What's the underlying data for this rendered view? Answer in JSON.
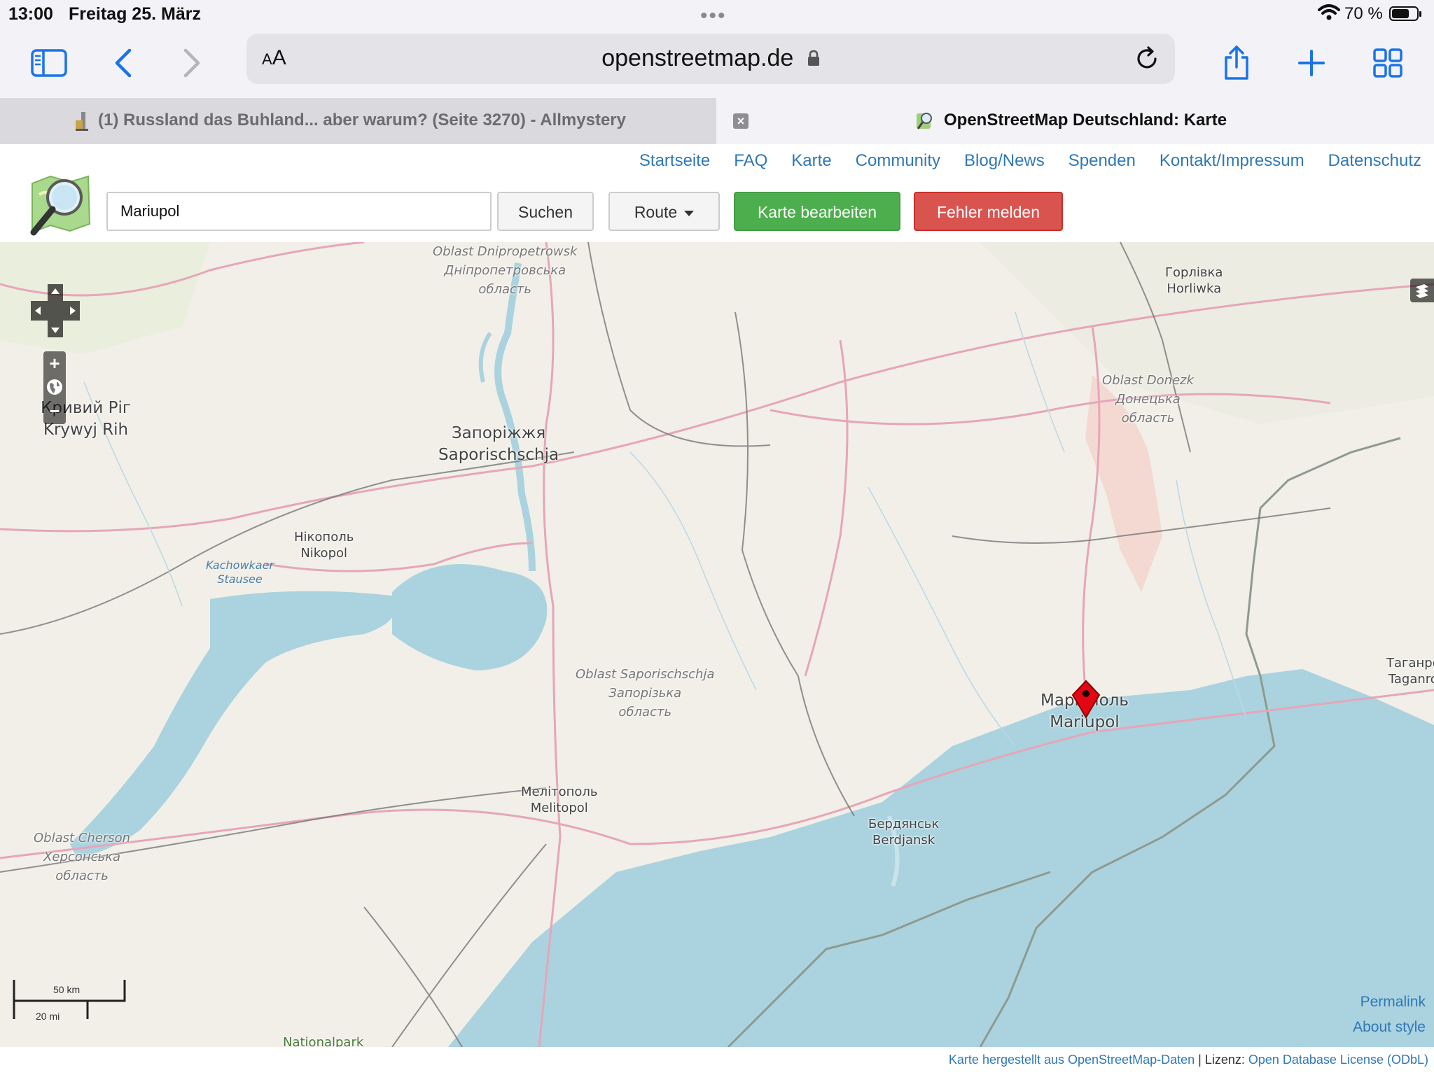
{
  "status_bar": {
    "time": "13:00",
    "date": "Freitag 25. März",
    "battery": "70 %",
    "battery_level": 0.7,
    "icons": [
      "wifi-icon",
      "battery-icon"
    ]
  },
  "browser": {
    "url": "openstreetmap.de",
    "reader_label_small": "A",
    "reader_label_large": "A",
    "toolbar_icons": [
      "sidebar-icon",
      "back-icon",
      "forward-icon",
      "lock-icon",
      "reload-icon",
      "share-icon",
      "new-tab-icon",
      "tabs-overview-icon"
    ],
    "tabs": [
      {
        "title": "(1) Russland das Buhland... aber warum? (Seite 3270) - Allmystery",
        "active": false
      },
      {
        "title": "OpenStreetMap Deutschland: Karte",
        "active": true
      }
    ]
  },
  "site": {
    "nav": [
      "Startseite",
      "FAQ",
      "Karte",
      "Community",
      "Blog/News",
      "Spenden",
      "Kontakt/Impressum",
      "Datenschutz"
    ],
    "search_value": "Mariupol",
    "buttons": {
      "search": "Suchen",
      "route": "Route",
      "edit": "Karte bearbeiten",
      "report": "Fehler melden"
    },
    "colors": {
      "edit": "#4cae4c",
      "report": "#d9534f",
      "link": "#2f78b5",
      "water": "#aad3df",
      "land": "#f1efe8"
    }
  },
  "map": {
    "labels": {
      "dnipro_oblast": [
        "Oblast Dnipropetrowsk",
        "Дніпропетровська",
        "область"
      ],
      "kryvyi_rih": [
        "Кривий Ріг",
        "Krywyj Rih"
      ],
      "zaporizhzhia": [
        "Запоріжжя",
        "Saporischschja"
      ],
      "horlivka": [
        "Горлівка",
        "Horliwka"
      ],
      "donetsk_oblast": [
        "Oblast Donezk",
        "Донецька",
        "область"
      ],
      "nikopol": [
        "Нікополь",
        "Nikopol"
      ],
      "reservoir": [
        "Kachowkaer",
        "Stausee"
      ],
      "zap_oblast": [
        "Oblast Saporischschja",
        "Запорізька",
        "область"
      ],
      "mariupol": [
        "Маріуполь",
        "Mariupol"
      ],
      "taganrog": [
        "Таганро",
        "Taganro"
      ],
      "melitopol": [
        "Мелітополь",
        "Melitopol"
      ],
      "berdyansk": [
        "Бердянськ",
        "Berdjansk"
      ],
      "kherson_oblast": [
        "Oblast Cherson",
        "Херсонська",
        "область"
      ],
      "nationalpark": "Nationalpark"
    },
    "scale": {
      "metric": "50 km",
      "imperial": "20 mi"
    },
    "links": {
      "permalink": "Permalink",
      "about_style": "About style"
    },
    "controls": {
      "zoom_in": "+",
      "zoom_out": "−"
    }
  },
  "footer": {
    "part1": "Karte hergestellt aus OpenStreetMap-Daten",
    "separator": " | Lizenz: ",
    "part2": "Open Database License (ODbL)"
  }
}
